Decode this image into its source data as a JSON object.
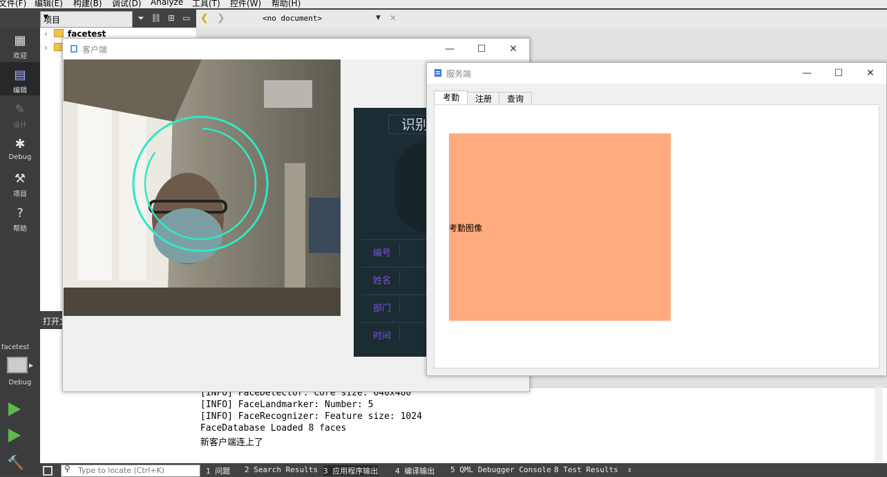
{
  "qt": {
    "menu": [
      "文件(F)",
      "编辑(E)",
      "构建(B)",
      "调试(D)",
      "Analyze",
      "工具(T)",
      "控件(W)",
      "帮助(H)"
    ],
    "project_combo": "项目",
    "document_combo": "<no document>",
    "modes": [
      "欢迎",
      "编辑",
      "设计",
      "Debug",
      "项目",
      "帮助"
    ],
    "tree": {
      "items": [
        "facetest",
        ""
      ]
    },
    "open_docs_title": "打开文",
    "kit": {
      "project": "facetest",
      "build": "Debug"
    },
    "output_lines": [
      "[INFO] FaceDetector: Core size: 640x480",
      "[INFO] FaceLandmarker: Number: 5",
      "[INFO] FaceRecognizer: Feature size: 1024",
      "FaceDatabase Loaded 8 faces",
      "新客户端连上了"
    ],
    "locator_placeholder": "Type to locate (Ctrl+K)",
    "pane_tabs": [
      "1 问题",
      "2 Search Results",
      "3 应用程序输出",
      "4 编译输出",
      "5 QML Debugger Console",
      "8 Test Results"
    ]
  },
  "client": {
    "title": "客户端",
    "result_title": "识别",
    "fields": [
      "编号",
      "姓名",
      "部门",
      "时间"
    ]
  },
  "server": {
    "title": "服务端",
    "tabs": [
      "考勤",
      "注册",
      "查询"
    ],
    "image_label": "考勤图像",
    "image_color": "#ffaa7f"
  },
  "colors": {
    "accent_ring": "#2ee8c6",
    "field_label": "#7b4fe0",
    "run_green": "#5fb84e"
  }
}
